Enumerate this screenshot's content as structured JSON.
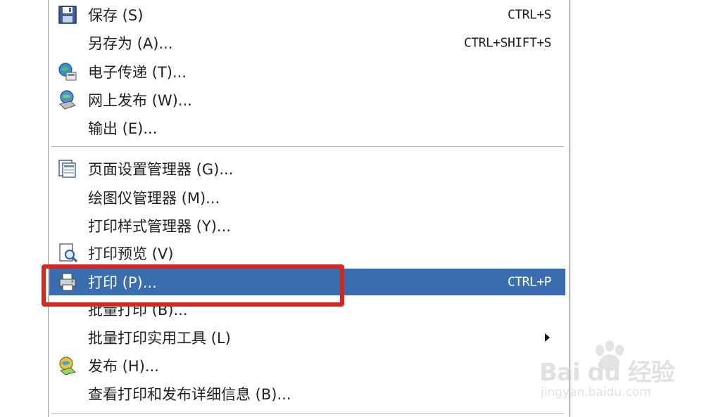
{
  "menu": {
    "items": [
      {
        "label": "保存 (S)",
        "shortcut": "CTRL+S",
        "icon": "save-icon"
      },
      {
        "label": "另存为 (A)...",
        "shortcut": "CTRL+SHIFT+S",
        "icon": ""
      },
      {
        "label": "电子传递 (T)...",
        "shortcut": "",
        "icon": "etransmit-icon"
      },
      {
        "label": "网上发布 (W)...",
        "shortcut": "",
        "icon": "publish-web-icon"
      },
      {
        "label": "输出 (E)...",
        "shortcut": "",
        "icon": ""
      },
      {
        "label": "页面设置管理器 (G)...",
        "shortcut": "",
        "icon": "page-setup-icon"
      },
      {
        "label": "绘图仪管理器 (M)...",
        "shortcut": "",
        "icon": ""
      },
      {
        "label": "打印样式管理器 (Y)...",
        "shortcut": "",
        "icon": ""
      },
      {
        "label": "打印预览 (V)",
        "shortcut": "",
        "icon": "print-preview-icon"
      },
      {
        "label": "打印 (P)...",
        "shortcut": "CTRL+P",
        "icon": "print-icon",
        "selected": true
      },
      {
        "label": "批量打印 (B)...",
        "shortcut": "",
        "icon": ""
      },
      {
        "label": "批量打印实用工具 (L)",
        "shortcut": "",
        "icon": "",
        "submenu": true
      },
      {
        "label": "发布 (H)...",
        "shortcut": "",
        "icon": "publish-icon"
      },
      {
        "label": "查看打印和发布详细信息 (B)...",
        "shortcut": "",
        "icon": ""
      }
    ]
  },
  "watermark": {
    "logo": "Bai du 经验",
    "url": "jingyan.baidu.com"
  },
  "colors": {
    "selection": "#3a6cb0",
    "highlight_box": "#d7261f"
  }
}
